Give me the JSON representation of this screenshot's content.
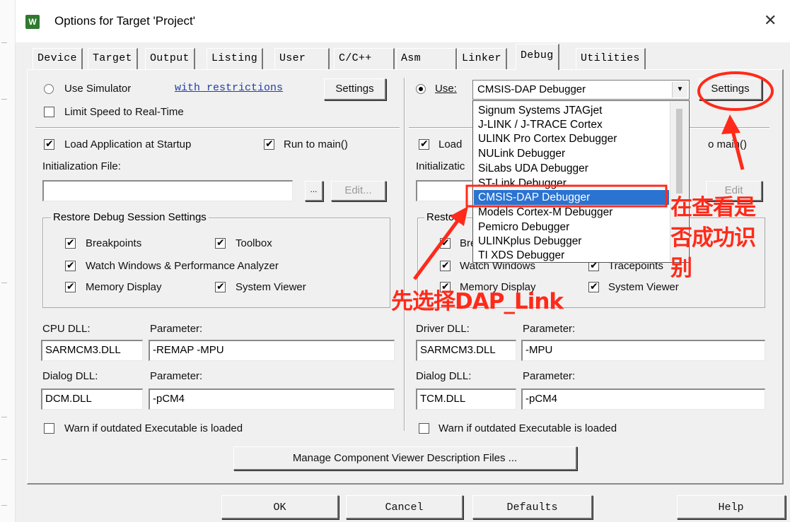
{
  "window": {
    "title": "Options for Target 'Project'",
    "app_icon": "W"
  },
  "tabs": [
    "Device",
    "Target",
    "Output",
    "Listing",
    "User",
    "C/C++",
    "Asm",
    "Linker",
    "Debug",
    "Utilities"
  ],
  "active_tab": "Debug",
  "left": {
    "use_simulator": "Use Simulator",
    "with_restrictions": "with restrictions",
    "settings": "Settings",
    "limit_speed": "Limit Speed to Real-Time",
    "load_app": "Load Application at Startup",
    "run_to_main": "Run to main()",
    "init_file_label": "Initialization File:",
    "browse": "...",
    "edit": "Edit...",
    "restore_title": "Restore Debug Session Settings",
    "breakpoints": "Breakpoints",
    "toolbox": "Toolbox",
    "watch_windows": "Watch Windows & Performance Analyzer",
    "memory_display": "Memory Display",
    "system_viewer": "System Viewer",
    "cpu_dll_label": "CPU DLL:",
    "cpu_param_label": "Parameter:",
    "cpu_dll": "SARMCM3.DLL",
    "cpu_param": "-REMAP -MPU",
    "dialog_dll_label": "Dialog DLL:",
    "dialog_param_label": "Parameter:",
    "dialog_dll": "DCM.DLL",
    "dialog_param": "-pCM4",
    "warn_outdated": "Warn if outdated Executable is loaded"
  },
  "right": {
    "use": "Use:",
    "selected_debugger": "CMSIS-DAP Debugger",
    "settings": "Settings",
    "load_partial": "Load",
    "run_to_main_partial": "o main()",
    "init_partial": "Initializatic",
    "edit_partial": "Edit",
    "restore_partial": "Restore",
    "breakpoints_partial": "Bre",
    "watch_windows": "Watch Windows",
    "tracepoints": "Tracepoints",
    "memory_display": "Memory Display",
    "system_viewer": "System Viewer",
    "driver_dll_label": "Driver DLL:",
    "driver_param_label": "Parameter:",
    "driver_dll": "SARMCM3.DLL",
    "driver_param": "-MPU",
    "dialog_dll_label": "Dialog DLL:",
    "dialog_param_label": "Parameter:",
    "dialog_dll": "TCM.DLL",
    "dialog_param": "-pCM4",
    "warn_outdated": "Warn if outdated Executable is loaded"
  },
  "debugger_options": [
    "Signum Systems JTAGjet",
    "J-LINK / J-TRACE Cortex",
    "ULINK Pro Cortex Debugger",
    "NULink Debugger",
    "SiLabs UDA Debugger",
    "ST-Link Debugger",
    "CMSIS-DAP Debugger",
    "Models Cortex-M Debugger",
    "Pemicro Debugger",
    "ULINKplus Debugger",
    "TI XDS Debugger"
  ],
  "selected_index": 6,
  "manage_component": "Manage Component Viewer Description Files ...",
  "footer": {
    "ok": "OK",
    "cancel": "Cancel",
    "defaults": "Defaults",
    "help": "Help"
  },
  "annotations": {
    "select_dap": "先选择DAP_Link",
    "check_line1": "在查看是",
    "check_line2": "否成功识",
    "check_line3": "别"
  },
  "colors": {
    "annotation": "#ff2a1a",
    "selection": "#2a73d0",
    "link": "#1f3fa6"
  }
}
